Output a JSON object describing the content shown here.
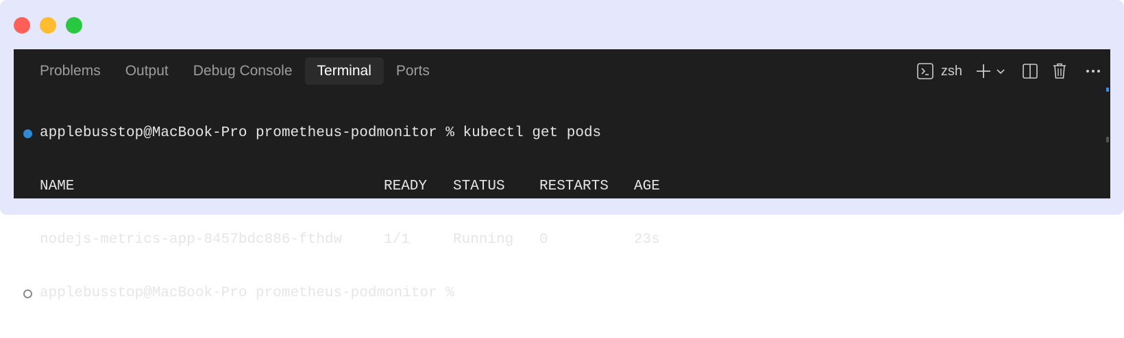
{
  "window": {
    "traffic_lights": [
      "close",
      "minimize",
      "maximize"
    ]
  },
  "panel": {
    "tabs": [
      {
        "label": "Problems",
        "active": false
      },
      {
        "label": "Output",
        "active": false
      },
      {
        "label": "Debug Console",
        "active": false
      },
      {
        "label": "Terminal",
        "active": true
      },
      {
        "label": "Ports",
        "active": false
      }
    ],
    "toolbar": {
      "shell_icon": "terminal-icon",
      "shell_label": "zsh",
      "add_icon": "plus-icon",
      "dropdown_icon": "chevron-down-icon",
      "split_icon": "split-editor-icon",
      "trash_icon": "trash-icon",
      "more_icon": "ellipsis-icon"
    }
  },
  "terminal": {
    "prompt": "applebusstop@MacBook-Pro prometheus-podmonitor %",
    "command": "kubectl get pods",
    "header": [
      "NAME",
      "READY",
      "STATUS",
      "RESTARTS",
      "AGE"
    ],
    "rows": [
      [
        "nodejs-metrics-app-8457bdc886-fthdw",
        "1/1",
        "Running",
        "0",
        "23s"
      ]
    ],
    "current_prompt": "applebusstop@MacBook-Pro prometheus-podmonitor %"
  },
  "colors": {
    "frame_bg": "#e5e8fc",
    "panel_bg": "#1e1e1e",
    "success_dot": "#2e8bd3",
    "text": "#e6e6e6"
  }
}
